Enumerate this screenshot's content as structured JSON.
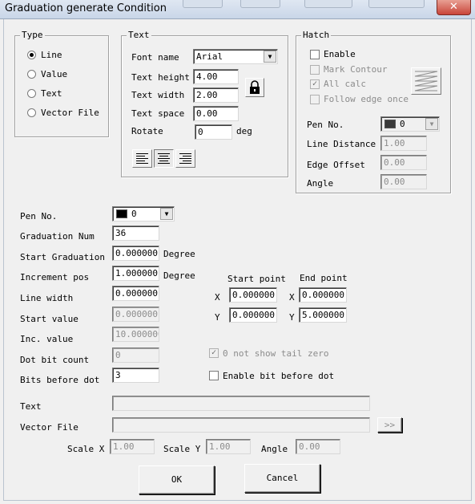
{
  "window": {
    "title": "Graduation generate Condition",
    "close_glyph": "✕"
  },
  "type_group": {
    "title": "Type",
    "options": [
      {
        "label": "Line",
        "selected": true
      },
      {
        "label": "Value",
        "selected": false
      },
      {
        "label": "Text",
        "selected": false
      },
      {
        "label": "Vector File",
        "selected": false
      }
    ]
  },
  "text_group": {
    "title": "Text",
    "font_name_label": "Font name",
    "font_name_value": "Arial",
    "text_height_label": "Text height",
    "text_height_value": "4.00",
    "text_width_label": "Text width",
    "text_width_value": "2.00",
    "text_space_label": "Text space",
    "text_space_value": "0.00",
    "rotate_label": "Rotate",
    "rotate_value": "0",
    "rotate_unit": "deg",
    "lock_icon": "lock-icon",
    "align_icons": [
      "align-left-icon",
      "align-center-icon",
      "align-right-icon"
    ],
    "align_selected": "center"
  },
  "hatch_group": {
    "title": "Hatch",
    "enable_label": "Enable",
    "enable_checked": false,
    "mark_contour_label": "Mark Contour",
    "mark_contour_checked": false,
    "all_calc_label": "All calc",
    "all_calc_checked": true,
    "follow_edge_label": "Follow edge once",
    "follow_edge_checked": false,
    "hatch_icon": "zigzag-hatch-icon",
    "pen_no_label": "Pen No.",
    "pen_no_value": "0",
    "line_distance_label": "Line Distance",
    "line_distance_value": "1.00",
    "edge_offset_label": "Edge Offset",
    "edge_offset_value": "0.00",
    "angle_label": "Angle",
    "angle_value": "0.00"
  },
  "main": {
    "pen_no_label": "Pen No.",
    "pen_no_value": "0",
    "pen_color": "#000000",
    "graduation_num_label": "Graduation Num",
    "graduation_num_value": "36",
    "start_graduation_label": "Start Graduation",
    "start_graduation_value": "0.000000",
    "start_graduation_unit": "Degree",
    "increment_pos_label": "Increment pos",
    "increment_pos_value": "1.000000",
    "increment_pos_unit": "Degree",
    "line_width_label": "Line width",
    "line_width_value": "0.000000",
    "start_value_label": "Start value",
    "start_value_value": "0.000000",
    "inc_value_label": "Inc. value",
    "inc_value_value": "10.000000",
    "dot_bit_count_label": "Dot bit count",
    "dot_bit_count_value": "0",
    "bits_before_dot_label": "Bits before dot",
    "bits_before_dot_value": "3",
    "start_point_label": "Start point",
    "end_point_label": "End point",
    "x_label": "X",
    "y_label": "Y",
    "start_x": "0.000000",
    "start_y": "0.000000",
    "end_x": "0.000000",
    "end_y": "5.000000",
    "no_tail_zero_label": "0 not show tail zero",
    "no_tail_zero_checked": true,
    "enable_bit_label": "Enable bit before dot",
    "enable_bit_checked": false,
    "text_label": "Text",
    "text_value": "",
    "vector_file_label": "Vector File",
    "vector_file_value": "",
    "browse_label": ">>",
    "scale_x_label": "Scale X",
    "scale_x_value": "1.00",
    "scale_y_label": "Scale Y",
    "scale_y_value": "1.00",
    "angle_label": "Angle",
    "angle_value": "0.00"
  },
  "buttons": {
    "ok_label": "OK",
    "cancel_label": "Cancel"
  }
}
